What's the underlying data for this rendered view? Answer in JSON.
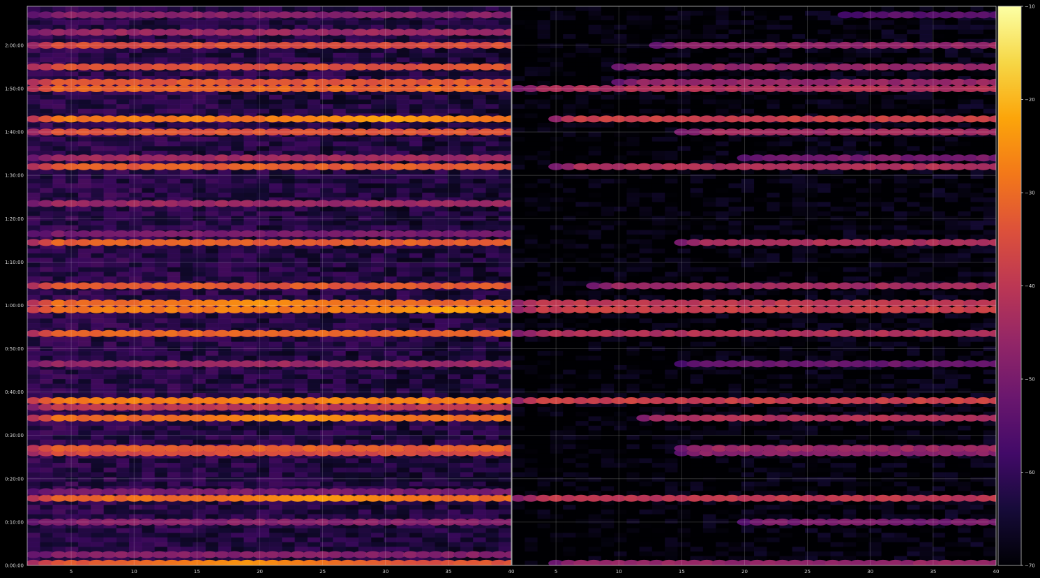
{
  "chart_data": {
    "type": "heatmap",
    "title": "",
    "colormap": "inferno",
    "background": "#000000",
    "grid": true,
    "panels": [
      {
        "name": "",
        "x_range": [
          1.5,
          40
        ],
        "x_ticks": [
          "5",
          "10",
          "15",
          "20",
          "25",
          "30",
          "35",
          "40"
        ],
        "x_tick_values": [
          5,
          10,
          15,
          20,
          25,
          30,
          35,
          40
        ],
        "y_range_seconds": [
          0,
          7740
        ],
        "y_ticks": [
          "0:00:00",
          "0:10:00",
          "0:20:00",
          "0:30:00",
          "0:40:00",
          "0:50:00",
          "1:00:00",
          "1:10:00",
          "1:20:00",
          "1:30:00",
          "1:40:00",
          "1:50:00",
          "2:00:00"
        ],
        "y_tick_values": [
          0,
          600,
          1200,
          1800,
          2400,
          3000,
          3600,
          4200,
          4800,
          5400,
          6000,
          6600,
          7200
        ],
        "background_level_db": -60,
        "bands": [
          {
            "time": "0:00:30",
            "db": -34,
            "x_start": 2,
            "x_end": 40,
            "peak_x": 19,
            "peak_db": -24
          },
          {
            "time": "0:02:30",
            "db": -48,
            "x_start": 2,
            "x_end": 40
          },
          {
            "time": "0:10:00",
            "db": -48,
            "x_start": 2,
            "x_end": 40
          },
          {
            "time": "0:15:30",
            "db": -30,
            "x_start": 2,
            "x_end": 40,
            "peak_x": 25,
            "peak_db": -23
          },
          {
            "time": "0:17:00",
            "db": -50,
            "x_start": 2,
            "x_end": 40
          },
          {
            "time": "0:26:00",
            "db": -36,
            "x_start": 2,
            "x_end": 40
          },
          {
            "time": "0:27:00",
            "db": -32,
            "x_start": 2,
            "x_end": 40
          },
          {
            "time": "0:34:00",
            "db": -30,
            "x_start": 2,
            "x_end": 40,
            "peak_x": 23,
            "peak_db": -23
          },
          {
            "time": "0:36:30",
            "db": -40,
            "x_start": 2,
            "x_end": 40
          },
          {
            "time": "0:38:00",
            "db": -27,
            "x_start": 2,
            "x_end": 40
          },
          {
            "time": "0:46:30",
            "db": -45,
            "x_start": 2,
            "x_end": 40
          },
          {
            "time": "0:53:30",
            "db": -31,
            "x_start": 2,
            "x_end": 40
          },
          {
            "time": "0:59:00",
            "db": -28,
            "x_start": 2,
            "x_end": 40,
            "peak_x": 35,
            "peak_db": -22
          },
          {
            "time": "1:00:30",
            "db": -30,
            "x_start": 2,
            "x_end": 40,
            "peak_x": 20,
            "peak_db": -24
          },
          {
            "time": "1:04:30",
            "db": -33,
            "x_start": 2,
            "x_end": 40
          },
          {
            "time": "1:14:30",
            "db": -32,
            "x_start": 2,
            "x_end": 40
          },
          {
            "time": "1:16:30",
            "db": -50,
            "x_start": 2,
            "x_end": 40
          },
          {
            "time": "1:23:30",
            "db": -45,
            "x_start": 2,
            "x_end": 40
          },
          {
            "time": "1:32:00",
            "db": -32,
            "x_start": 2,
            "x_end": 40
          },
          {
            "time": "1:34:00",
            "db": -44,
            "x_start": 2,
            "x_end": 40
          },
          {
            "time": "1:40:00",
            "db": -34,
            "x_start": 2,
            "x_end": 40
          },
          {
            "time": "1:43:00",
            "db": -28,
            "x_start": 2,
            "x_end": 40,
            "peak_x": 30,
            "peak_db": -22
          },
          {
            "time": "1:50:00",
            "db": -31,
            "x_start": 2,
            "x_end": 40
          },
          {
            "time": "1:51:30",
            "db": -33,
            "x_start": 2,
            "x_end": 40
          },
          {
            "time": "1:55:00",
            "db": -34,
            "x_start": 2,
            "x_end": 40
          },
          {
            "time": "2:00:00",
            "db": -35,
            "x_start": 2,
            "x_end": 40
          },
          {
            "time": "2:03:00",
            "db": -45,
            "x_start": 2,
            "x_end": 40
          },
          {
            "time": "2:07:00",
            "db": -48,
            "x_start": 2,
            "x_end": 40
          }
        ]
      },
      {
        "name": "",
        "x_range": [
          1.5,
          40
        ],
        "x_ticks": [
          "5",
          "10",
          "15",
          "20",
          "25",
          "30",
          "35",
          "40"
        ],
        "x_tick_values": [
          5,
          10,
          15,
          20,
          25,
          30,
          35,
          40
        ],
        "y_range_seconds": [
          0,
          7740
        ],
        "y_ticks": [],
        "y_tick_values": [],
        "background_level_db": -69,
        "bands": [
          {
            "time": "0:00:30",
            "db": -46,
            "x_start": 5,
            "x_end": 40
          },
          {
            "time": "0:10:00",
            "db": -50,
            "x_start": 20,
            "x_end": 40
          },
          {
            "time": "0:15:30",
            "db": -40,
            "x_start": 2,
            "x_end": 40
          },
          {
            "time": "0:26:00",
            "db": -48,
            "x_start": 15,
            "x_end": 40
          },
          {
            "time": "0:27:00",
            "db": -45,
            "x_start": 15,
            "x_end": 40
          },
          {
            "time": "0:34:00",
            "db": -42,
            "x_start": 12,
            "x_end": 40
          },
          {
            "time": "0:38:00",
            "db": -38,
            "x_start": 2,
            "x_end": 40
          },
          {
            "time": "0:46:30",
            "db": -52,
            "x_start": 15,
            "x_end": 40
          },
          {
            "time": "0:53:30",
            "db": -42,
            "x_start": 2,
            "x_end": 40
          },
          {
            "time": "0:59:00",
            "db": -38,
            "x_start": 2,
            "x_end": 40
          },
          {
            "time": "1:00:30",
            "db": -40,
            "x_start": 2,
            "x_end": 40
          },
          {
            "time": "1:04:30",
            "db": -44,
            "x_start": 8,
            "x_end": 40
          },
          {
            "time": "1:14:30",
            "db": -42,
            "x_start": 15,
            "x_end": 40
          },
          {
            "time": "1:32:00",
            "db": -42,
            "x_start": 5,
            "x_end": 40
          },
          {
            "time": "1:34:00",
            "db": -50,
            "x_start": 20,
            "x_end": 40
          },
          {
            "time": "1:40:00",
            "db": -44,
            "x_start": 15,
            "x_end": 40
          },
          {
            "time": "1:43:00",
            "db": -38,
            "x_start": 5,
            "x_end": 40
          },
          {
            "time": "1:50:00",
            "db": -42,
            "x_start": 2,
            "x_end": 40
          },
          {
            "time": "1:51:30",
            "db": -46,
            "x_start": 10,
            "x_end": 40
          },
          {
            "time": "1:55:00",
            "db": -46,
            "x_start": 10,
            "x_end": 40
          },
          {
            "time": "2:00:00",
            "db": -46,
            "x_start": 13,
            "x_end": 40
          },
          {
            "time": "2:07:00",
            "db": -55,
            "x_start": 28,
            "x_end": 40
          }
        ]
      }
    ],
    "colorbar": {
      "min": -70,
      "max": -10,
      "ticks": [
        "−70",
        "−60",
        "−50",
        "−40",
        "−30",
        "−20",
        "−10"
      ],
      "tick_values": [
        -70,
        -60,
        -50,
        -40,
        -30,
        -20,
        -10
      ]
    }
  }
}
